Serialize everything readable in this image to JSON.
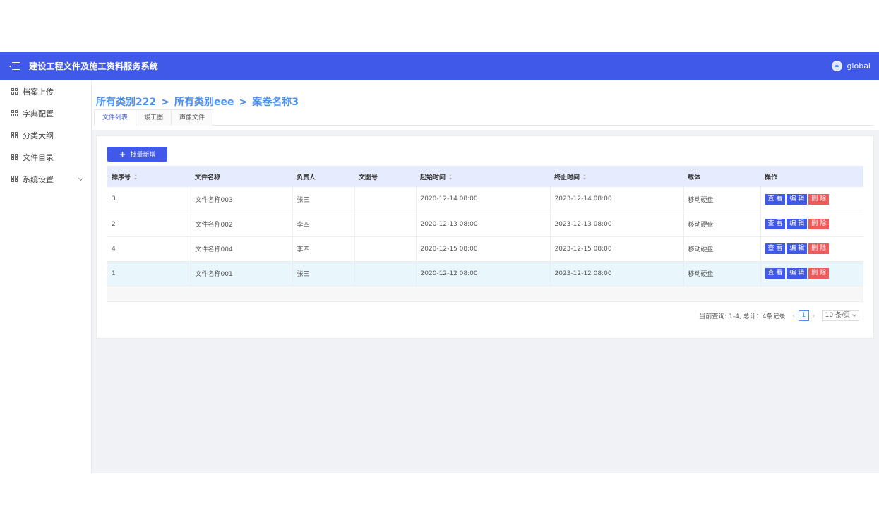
{
  "header": {
    "title": "建设工程文件及施工资料服务系统",
    "user": "global"
  },
  "sidebar": {
    "items": [
      {
        "label": "档案上传"
      },
      {
        "label": "字典配置"
      },
      {
        "label": "分类大纲"
      },
      {
        "label": "文件目录"
      },
      {
        "label": "系统设置",
        "expandable": true
      }
    ]
  },
  "breadcrumb": {
    "parts": [
      "所有类别222",
      "所有类别eee",
      "案卷名称3"
    ],
    "separator": ">"
  },
  "tabs": [
    {
      "label": "文件列表",
      "active": true
    },
    {
      "label": "竣工图"
    },
    {
      "label": "声像文件"
    }
  ],
  "toolbar": {
    "batch_add": "批量新增"
  },
  "table": {
    "columns": [
      "排序号",
      "文件名称",
      "负责人",
      "文图号",
      "起始时间",
      "终止时间",
      "载体",
      "操作"
    ],
    "actions": {
      "view": "查 看",
      "edit": "编 辑",
      "delete": "删 除"
    },
    "rows": [
      {
        "order": "3",
        "name": "文件名称003",
        "owner": "张三",
        "drawing_no": "",
        "start": "2020-12-14 08:00",
        "end": "2023-12-14 08:00",
        "carrier": "移动硬盘"
      },
      {
        "order": "2",
        "name": "文件名称002",
        "owner": "李四",
        "drawing_no": "",
        "start": "2020-12-13 08:00",
        "end": "2023-12-13 08:00",
        "carrier": "移动硬盘"
      },
      {
        "order": "4",
        "name": "文件名称004",
        "owner": "李四",
        "drawing_no": "",
        "start": "2020-12-15 08:00",
        "end": "2023-12-15 08:00",
        "carrier": "移动硬盘"
      },
      {
        "order": "1",
        "name": "文件名称001",
        "owner": "张三",
        "drawing_no": "",
        "start": "2020-12-12 08:00",
        "end": "2023-12-12 08:00",
        "carrier": "移动硬盘"
      }
    ]
  },
  "pagination": {
    "summary": "当前查询: 1-4, 总计：4条记录",
    "current_page": "1",
    "page_size": "10 条/页"
  },
  "colors": {
    "primary": "#4159e8",
    "link": "#4a8ef0",
    "danger": "#f05a5a",
    "header_row": "#e6ebfd",
    "highlight_row": "#e9f7fd"
  }
}
